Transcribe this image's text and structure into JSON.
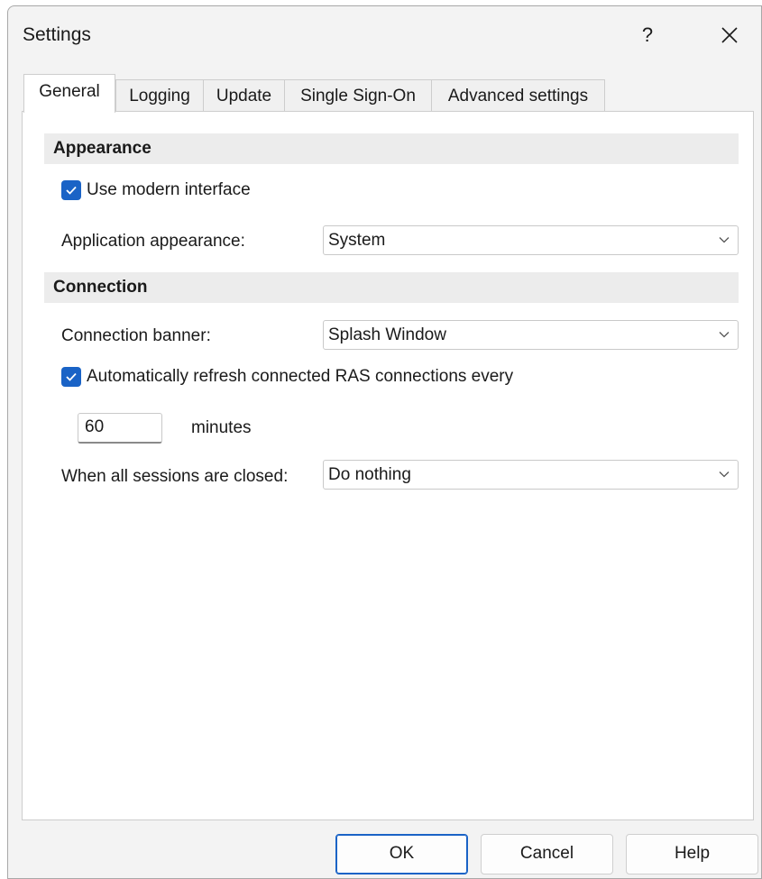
{
  "window": {
    "title": "Settings",
    "help_glyph": "?"
  },
  "tabs": [
    {
      "label": "General",
      "active": true
    },
    {
      "label": "Logging",
      "active": false
    },
    {
      "label": "Update",
      "active": false
    },
    {
      "label": "Single Sign-On",
      "active": false
    },
    {
      "label": "Advanced settings",
      "active": false
    }
  ],
  "appearance": {
    "header": "Appearance",
    "modern_interface": {
      "label": "Use modern interface",
      "checked": true
    },
    "app_appearance": {
      "label": "Application appearance:",
      "value": "System"
    }
  },
  "connection": {
    "header": "Connection",
    "banner": {
      "label": "Connection banner:",
      "value": "Splash Window"
    },
    "auto_refresh": {
      "label": "Automatically refresh connected RAS connections every",
      "checked": true
    },
    "refresh_interval": {
      "value": "60",
      "unit_label": "minutes"
    },
    "sessions_closed": {
      "label": "When all sessions are closed:",
      "value": "Do nothing"
    }
  },
  "buttons": {
    "ok": "OK",
    "cancel": "Cancel",
    "help": "Help"
  },
  "colors": {
    "accent": "#1a63c6",
    "dialog_bg": "#f3f3f3",
    "panel_bg": "#ffffff",
    "section_bg": "#ececec"
  },
  "icons": {
    "close": "close-icon",
    "check": "checkmark-icon",
    "dropdown": "chevron-down-icon"
  }
}
